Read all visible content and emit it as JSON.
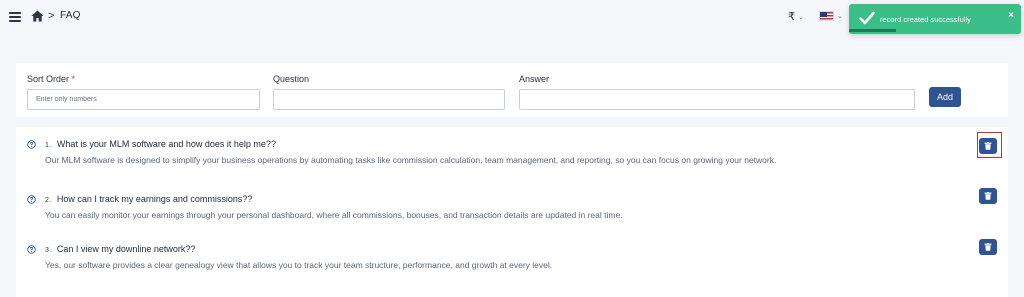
{
  "header": {
    "breadcrumb_separator": ">",
    "page_title": "FAQ",
    "currency_symbol": "₹",
    "language_flag": "us-flag"
  },
  "toast": {
    "message": "record created successfully",
    "close_label": "×",
    "color": "#3bbf88"
  },
  "form": {
    "sort_order_label": "Sort Order",
    "required_mark": "*",
    "sort_order_placeholder": "Enter only numbers",
    "sort_order_value": "",
    "question_label": "Question",
    "question_value": "",
    "answer_label": "Answer",
    "answer_value": "",
    "add_label": "Add"
  },
  "faqs": [
    {
      "number": "1.",
      "question": "What is your MLM software and how does it help me??",
      "answer": "Our MLM software is designed to simplify your business operations by automating tasks like commission calculation, team management, and reporting, so you can focus on growing your network."
    },
    {
      "number": "2.",
      "question": "How can I track my earnings and commissions??",
      "answer": "You can easily monitor your earnings through your personal dashboard, where all commissions, bonuses, and transaction details are updated in real time."
    },
    {
      "number": "3.",
      "question": "Can I view my downline network??",
      "answer": "Yes, our software provides a clear genealogy view that allows you to track your team structure, performance, and growth at every level."
    }
  ],
  "colors": {
    "primary": "#2f5493",
    "success": "#3bbf88",
    "highlight": "#e02424"
  }
}
